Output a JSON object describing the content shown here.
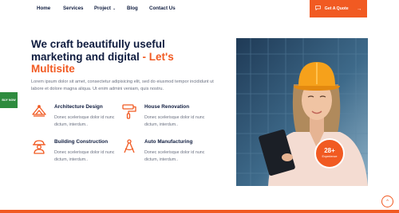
{
  "nav": {
    "items": [
      {
        "label": "Home"
      },
      {
        "label": "Services"
      },
      {
        "label": "Project"
      },
      {
        "label": "Blog"
      },
      {
        "label": "Contact Us"
      }
    ],
    "quote_button": "Get A Quote"
  },
  "side": {
    "buy_now": "BUY NOW"
  },
  "hero": {
    "headline": "We craft beautifully useful marketing and digital",
    "headline_accent": "- Let's Multisite",
    "intro": "Lorem ipsum dolor sit amet, consectetur adipisicing elit, sed do eiusmod tempor incididunt ut labore et dolore magna aliqua. Ut enim admini veniam, quis nostru."
  },
  "services": [
    {
      "title": "Architecture Design",
      "desc": "Donec scelerisque dolor id nunc dictum, interdum..",
      "icon": "architecture-icon"
    },
    {
      "title": "House Renovation",
      "desc": "Donec scelerisque dolor id nunc dictum, interdum..",
      "icon": "paint-roller-icon"
    },
    {
      "title": "Building Construction",
      "desc": "Donec scelerisque dolor id nunc dictum, interdum..",
      "icon": "construction-worker-icon"
    },
    {
      "title": "Auto Manufacturing",
      "desc": "Donec scelerisque dolor id nunc dictum, interdum..",
      "icon": "compass-icon"
    }
  ],
  "badge": {
    "number": "28+",
    "label": "Experience"
  },
  "colors": {
    "accent": "#f15a22",
    "navy": "#0f1c3f",
    "green": "#2e8b3e",
    "text_muted": "#6a7080"
  }
}
